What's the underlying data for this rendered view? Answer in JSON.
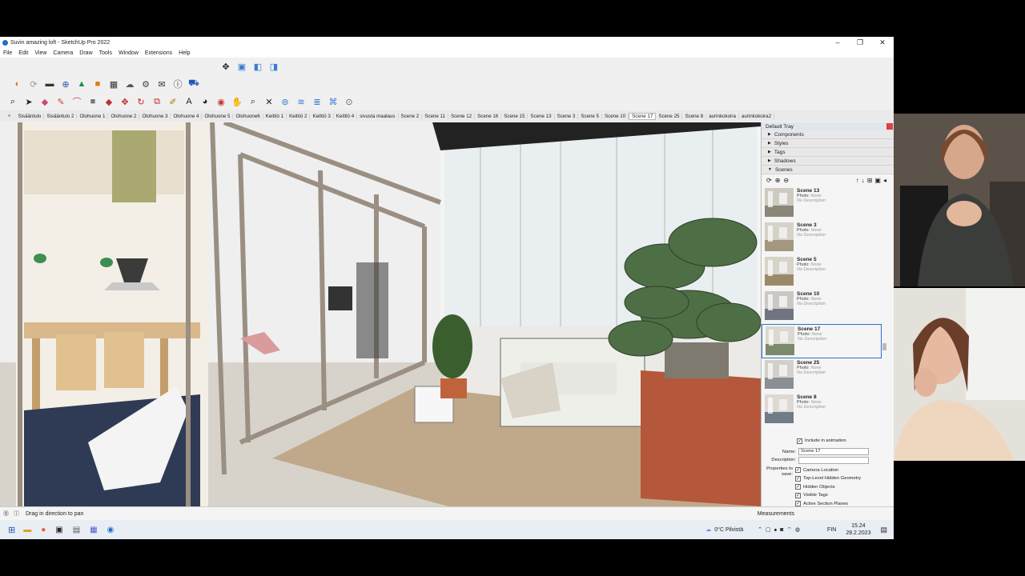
{
  "window": {
    "title": "Suvin amazing loft - SketchUp Pro 2022",
    "min": "–",
    "max": "❐",
    "close": "✕"
  },
  "menu": [
    "File",
    "Edit",
    "View",
    "Camera",
    "Draw",
    "Tools",
    "Window",
    "Extensions",
    "Help"
  ],
  "scene_tabs": [
    "Sisääntulo",
    "Sisääntulo 2",
    "Olohuone 1",
    "Olohuone 2",
    "Olohuone 3",
    "Olohuone 4",
    "Olohuone 5",
    "Olohuone6",
    "Keittiö 1",
    "Keittiö 2",
    "Keittiö 3",
    "Keittiö 4",
    "sivusta maalaus",
    "Scene 2",
    "Scene 11",
    "Scene 12",
    "Scene 16",
    "Scene 15",
    "Scene 13",
    "Scene 3",
    "Scene 5",
    "Scene 10",
    "Scene 17",
    "Scene 25",
    "Scene 8",
    "aurinkokoira",
    "aurinkokoira2"
  ],
  "active_tab": "Scene 17",
  "tray": {
    "title": "Default Tray",
    "panels": [
      "Components",
      "Styles",
      "Tags",
      "Shadows",
      "Scenes"
    ],
    "scenes": [
      {
        "name": "Scene 13",
        "photo_label": "Photo:",
        "photo": "None",
        "desc": "No Description"
      },
      {
        "name": "Scene 3",
        "photo_label": "Photo:",
        "photo": "None",
        "desc": "No Description"
      },
      {
        "name": "Scene 5",
        "photo_label": "Photo:",
        "photo": "None",
        "desc": "No Description"
      },
      {
        "name": "Scene 10",
        "photo_label": "Photo:",
        "photo": "None",
        "desc": "No Description"
      },
      {
        "name": "Scene 17",
        "photo_label": "Photo:",
        "photo": "None",
        "desc": "No Description"
      },
      {
        "name": "Scene 25",
        "photo_label": "Photo:",
        "photo": "None",
        "desc": "No Description"
      },
      {
        "name": "Scene 8",
        "photo_label": "Photo:",
        "photo": "None",
        "desc": "No Description"
      }
    ],
    "selected_scene": "Scene 17",
    "include_animation": "Include in animation",
    "name_label": "Name:",
    "name_value": "Scene 17",
    "desc_label": "Description:",
    "props_label": "Properties to save:",
    "props": [
      "Camera Location",
      "Top-Level Hidden Geometry",
      "Hidden Objects",
      "Visible Tags",
      "Active Section Planes"
    ]
  },
  "status": {
    "hint": "Drag in direction to pan",
    "measurements": "Measurements"
  },
  "taskbar": {
    "weather": "0°C Pilvistä",
    "lang": "FIN",
    "time": "15.24",
    "date": "28.2.2023"
  }
}
